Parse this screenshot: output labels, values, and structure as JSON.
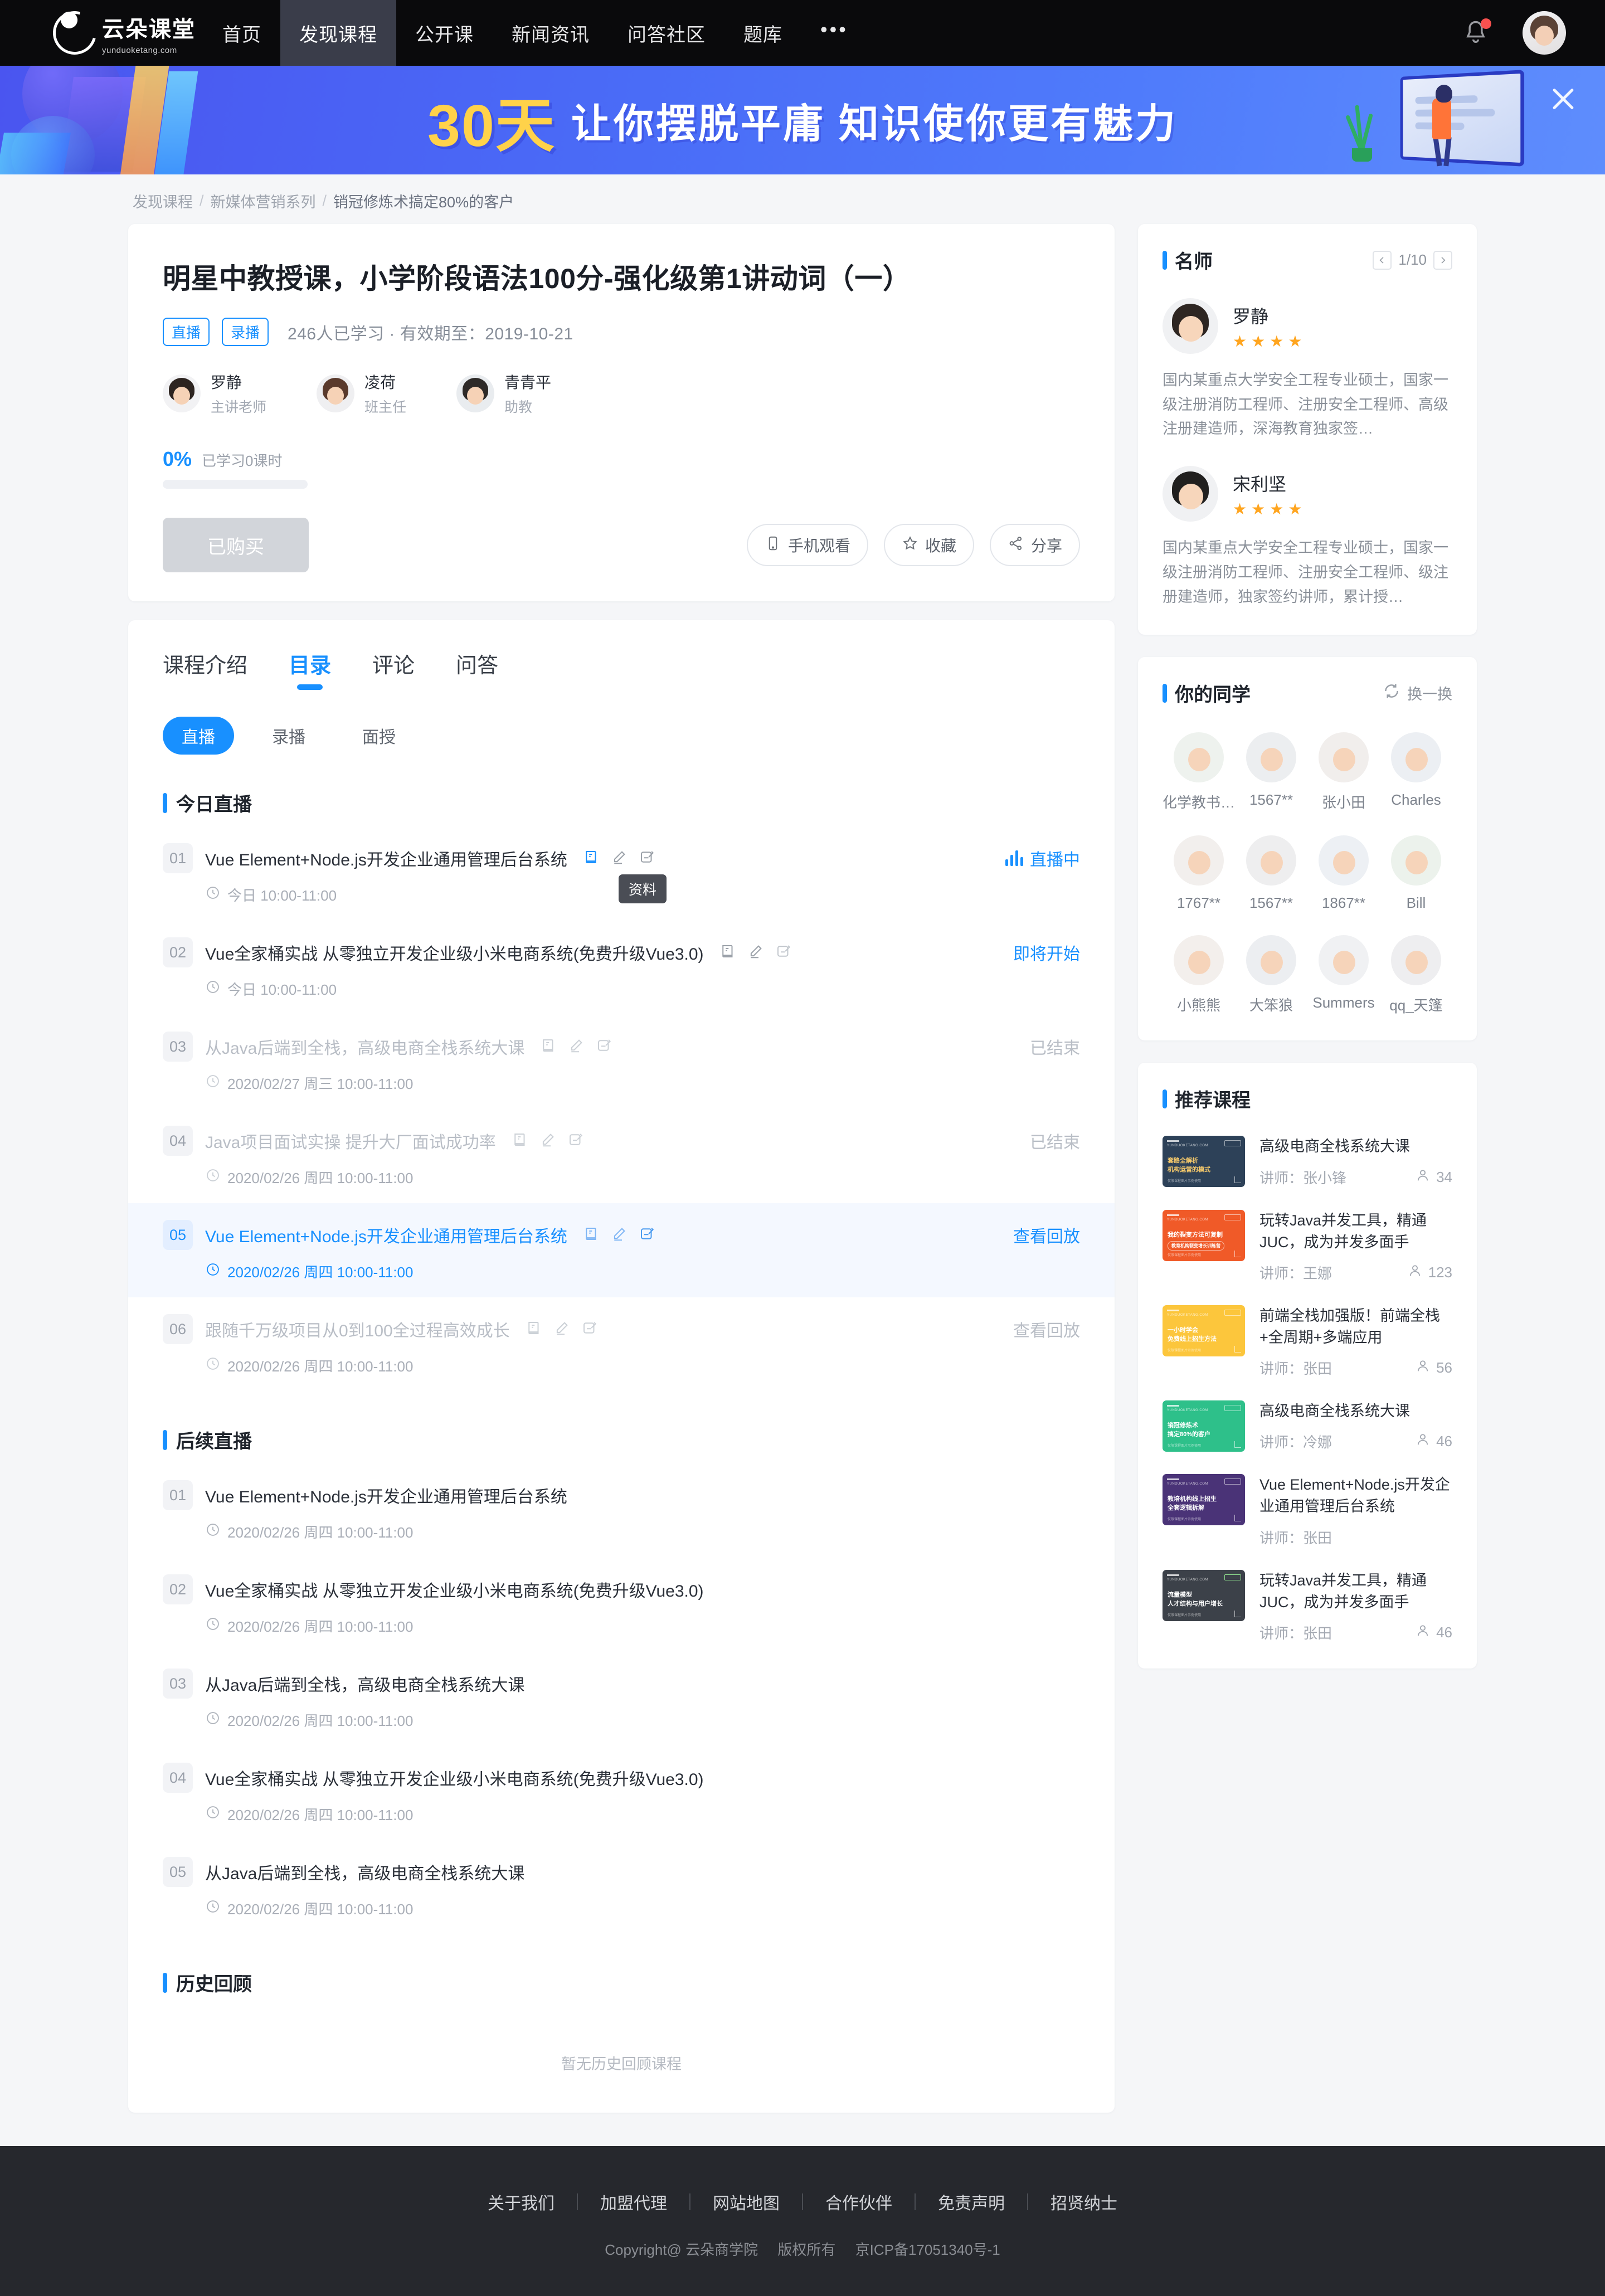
{
  "nav": {
    "logo_cn": "云朵课堂",
    "logo_en": "yunduoketang.com",
    "items": [
      {
        "label": "首页",
        "active": false
      },
      {
        "label": "发现课程",
        "active": true
      },
      {
        "label": "公开课",
        "active": false
      },
      {
        "label": "新闻资讯",
        "active": false
      },
      {
        "label": "问答社区",
        "active": false
      },
      {
        "label": "题库",
        "active": false
      }
    ],
    "more": "•••"
  },
  "banner": {
    "highlight": "30天",
    "text": "让你摆脱平庸 知识使你更有魅力"
  },
  "breadcrumb": {
    "items": [
      "发现课程",
      "新媒体营销系列",
      "销冠修炼术搞定80%的客户"
    ],
    "separator": "/"
  },
  "course": {
    "title": "明星中教授课，小学阶段语法100分-强化级第1讲动词（一）",
    "tags": [
      "直播",
      "录播"
    ],
    "meta": "246人已学习 · 有效期至：2019-10-21",
    "teachers": [
      {
        "name": "罗静",
        "role": "主讲老师"
      },
      {
        "name": "凌荷",
        "role": "班主任"
      },
      {
        "name": "青青平",
        "role": "助教"
      }
    ],
    "progress_pct": "0%",
    "progress_label": "已学习0课时",
    "buy_button": "已购买",
    "actions": [
      {
        "label": "手机观看",
        "icon": "mobile-icon"
      },
      {
        "label": "收藏",
        "icon": "star-icon"
      },
      {
        "label": "分享",
        "icon": "share-icon"
      }
    ]
  },
  "catalog": {
    "tabs": [
      {
        "label": "课程介绍",
        "active": false
      },
      {
        "label": "目录",
        "active": true
      },
      {
        "label": "评论",
        "active": false
      },
      {
        "label": "问答",
        "active": false
      }
    ],
    "segments": [
      {
        "label": "直播",
        "active": true
      },
      {
        "label": "录播",
        "active": false
      },
      {
        "label": "面授",
        "active": false
      }
    ],
    "tooltip": "资料",
    "sections": [
      {
        "title": "今日直播",
        "lessons": [
          {
            "num": "01",
            "name": "Vue Element+Node.js开发企业通用管理后台系统",
            "time": "今日 10:00-11:00",
            "status": "直播中",
            "status_type": "live",
            "has_icons": true,
            "state": "normal"
          },
          {
            "num": "02",
            "name": "Vue全家桶实战 从零独立开发企业级小米电商系统(免费升级Vue3.0)",
            "time": "今日 10:00-11:00",
            "status": "即将开始",
            "status_type": "soon",
            "has_icons": true,
            "state": "normal"
          },
          {
            "num": "03",
            "name": "从Java后端到全栈，高级电商全栈系统大课",
            "time": "2020/02/27 周三 10:00-11:00",
            "status": "已结束",
            "status_type": "end",
            "has_icons": true,
            "state": "dim"
          },
          {
            "num": "04",
            "name": "Java项目面试实操 提升大厂面试成功率",
            "time": "2020/02/26 周四 10:00-11:00",
            "status": "已结束",
            "status_type": "end",
            "has_icons": true,
            "state": "dim"
          },
          {
            "num": "05",
            "name": "Vue Element+Node.js开发企业通用管理后台系统",
            "time": "2020/02/26 周四 10:00-11:00",
            "status": "查看回放",
            "status_type": "replay",
            "has_icons": true,
            "state": "hl"
          },
          {
            "num": "06",
            "name": "跟随千万级项目从0到100全过程高效成长",
            "time": "2020/02/26 周四 10:00-11:00",
            "status": "查看回放",
            "status_type": "replay",
            "has_icons": true,
            "state": "dim"
          }
        ]
      },
      {
        "title": "后续直播",
        "lessons": [
          {
            "num": "01",
            "name": "Vue Element+Node.js开发企业通用管理后台系统",
            "time": "2020/02/26 周四 10:00-11:00",
            "status": "",
            "status_type": "none",
            "has_icons": false,
            "state": "normal"
          },
          {
            "num": "02",
            "name": "Vue全家桶实战 从零独立开发企业级小米电商系统(免费升级Vue3.0)",
            "time": "2020/02/26 周四 10:00-11:00",
            "status": "",
            "status_type": "none",
            "has_icons": false,
            "state": "normal"
          },
          {
            "num": "03",
            "name": "从Java后端到全栈，高级电商全栈系统大课",
            "time": "2020/02/26 周四 10:00-11:00",
            "status": "",
            "status_type": "none",
            "has_icons": false,
            "state": "normal"
          },
          {
            "num": "04",
            "name": "Vue全家桶实战 从零独立开发企业级小米电商系统(免费升级Vue3.0)",
            "time": "2020/02/26 周四 10:00-11:00",
            "status": "",
            "status_type": "none",
            "has_icons": false,
            "state": "normal"
          },
          {
            "num": "05",
            "name": "从Java后端到全栈，高级电商全栈系统大课",
            "time": "2020/02/26 周四 10:00-11:00",
            "status": "",
            "status_type": "none",
            "has_icons": false,
            "state": "normal"
          }
        ]
      },
      {
        "title": "历史回顾",
        "lessons": [],
        "empty_text": "暂无历史回顾课程"
      }
    ]
  },
  "sidebar": {
    "teachers_panel": {
      "title": "名师",
      "page": "1/10",
      "list": [
        {
          "name": "罗静",
          "stars": 4,
          "desc": "国内某重点大学安全工程专业硕士，国家一级注册消防工程师、注册安全工程师、高级注册建造师，深海教育独家签…"
        },
        {
          "name": "宋利坚",
          "stars": 4,
          "desc": "国内某重点大学安全工程专业硕士，国家一级注册消防工程师、注册安全工程师、级注册建造师，独家签约讲师，累计授…"
        }
      ]
    },
    "classmates_panel": {
      "title": "你的同学",
      "refresh_label": "换一换",
      "list": [
        {
          "name": "化学教书…"
        },
        {
          "name": "1567**"
        },
        {
          "name": "张小田"
        },
        {
          "name": "Charles"
        },
        {
          "name": "1767**"
        },
        {
          "name": "1567**"
        },
        {
          "name": "1867**"
        },
        {
          "name": "Bill"
        },
        {
          "name": "小熊熊"
        },
        {
          "name": "大笨狼"
        },
        {
          "name": "Summers"
        },
        {
          "name": "qq_天篷"
        }
      ]
    },
    "recommend_panel": {
      "title": "推荐课程",
      "list": [
        {
          "name": "高级电商全栈系统大课",
          "teacher": "讲师：张小锋",
          "count": "34",
          "thumb_color": "#2d4158",
          "thumb_t1": "套路全解析",
          "thumb_t2": "机构运营的模式"
        },
        {
          "name": "玩转Java并发工具，精通JUC，成为并发多面手",
          "teacher": "讲师：王娜",
          "count": "123",
          "thumb_color": "#f05a28",
          "thumb_t1": "我的裂变方法可复制",
          "thumb_t2": "教育机构裂变增长训练营"
        },
        {
          "name": "前端全栈加强版！前端全栈+全周期+多端应用",
          "teacher": "讲师：张田",
          "count": "56",
          "thumb_color": "#fcc63c",
          "thumb_t1": "一小时学会",
          "thumb_t2": "免费线上招生方法"
        },
        {
          "name": "高级电商全栈系统大课",
          "teacher": "讲师：冷娜",
          "count": "46",
          "thumb_color": "#2ec08a",
          "thumb_t1": "销冠修炼术",
          "thumb_t2": "搞定80%的客户"
        },
        {
          "name": "Vue Element+Node.js开发企业通用管理后台系统",
          "teacher": "讲师：张田",
          "count": "",
          "thumb_color": "#4a3377",
          "thumb_t1": "教培机构线上招生",
          "thumb_t2": "全套逻辑拆解"
        },
        {
          "name": "玩转Java并发工具，精通JUC，成为并发多面手",
          "teacher": "讲师：张田",
          "count": "46",
          "thumb_color": "#3c4149",
          "thumb_t1": "流量模型",
          "thumb_t2": "人才结构与用户增长"
        }
      ],
      "thumb_brand": "YUNDUOKETANG.COM",
      "thumb_badge": "云朵课堂",
      "thumb_footer": "仅限课程图片示例使用"
    }
  },
  "footer": {
    "links": [
      "关于我们",
      "加盟代理",
      "网站地图",
      "合作伙伴",
      "免责声明",
      "招贤纳士"
    ],
    "copyright": "Copyright@ 云朵商学院",
    "rights": "版权所有",
    "icp": "京ICP备17051340号-1"
  },
  "colors": {
    "accent": "#1890ff",
    "star": "#ffa51f",
    "nav_bg": "#0a0a0c",
    "footer_bg": "#26282d"
  }
}
